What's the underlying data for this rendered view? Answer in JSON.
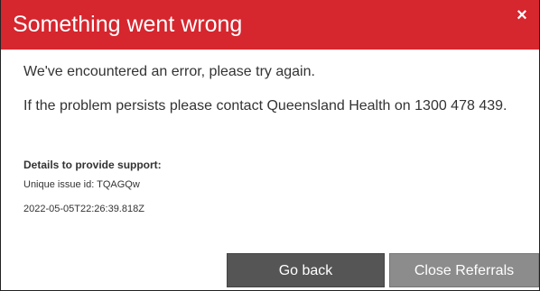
{
  "dialog": {
    "title": "Something went wrong",
    "close_icon": "×",
    "message_line1": "We've encountered an error, please try again.",
    "message_line2": "If the problem persists please contact Queensland Health on 1300 478 439.",
    "details_label": "Details to provide support:",
    "issue_id": "Unique issue id: TQAGQw",
    "timestamp": "2022-05-05T22:26:39.818Z",
    "buttons": {
      "go_back": "Go back",
      "close_referrals": "Close Referrals"
    },
    "colors": {
      "header": "#d6262e",
      "primary_button": "#555555",
      "secondary_button": "#8c8c8c"
    }
  }
}
